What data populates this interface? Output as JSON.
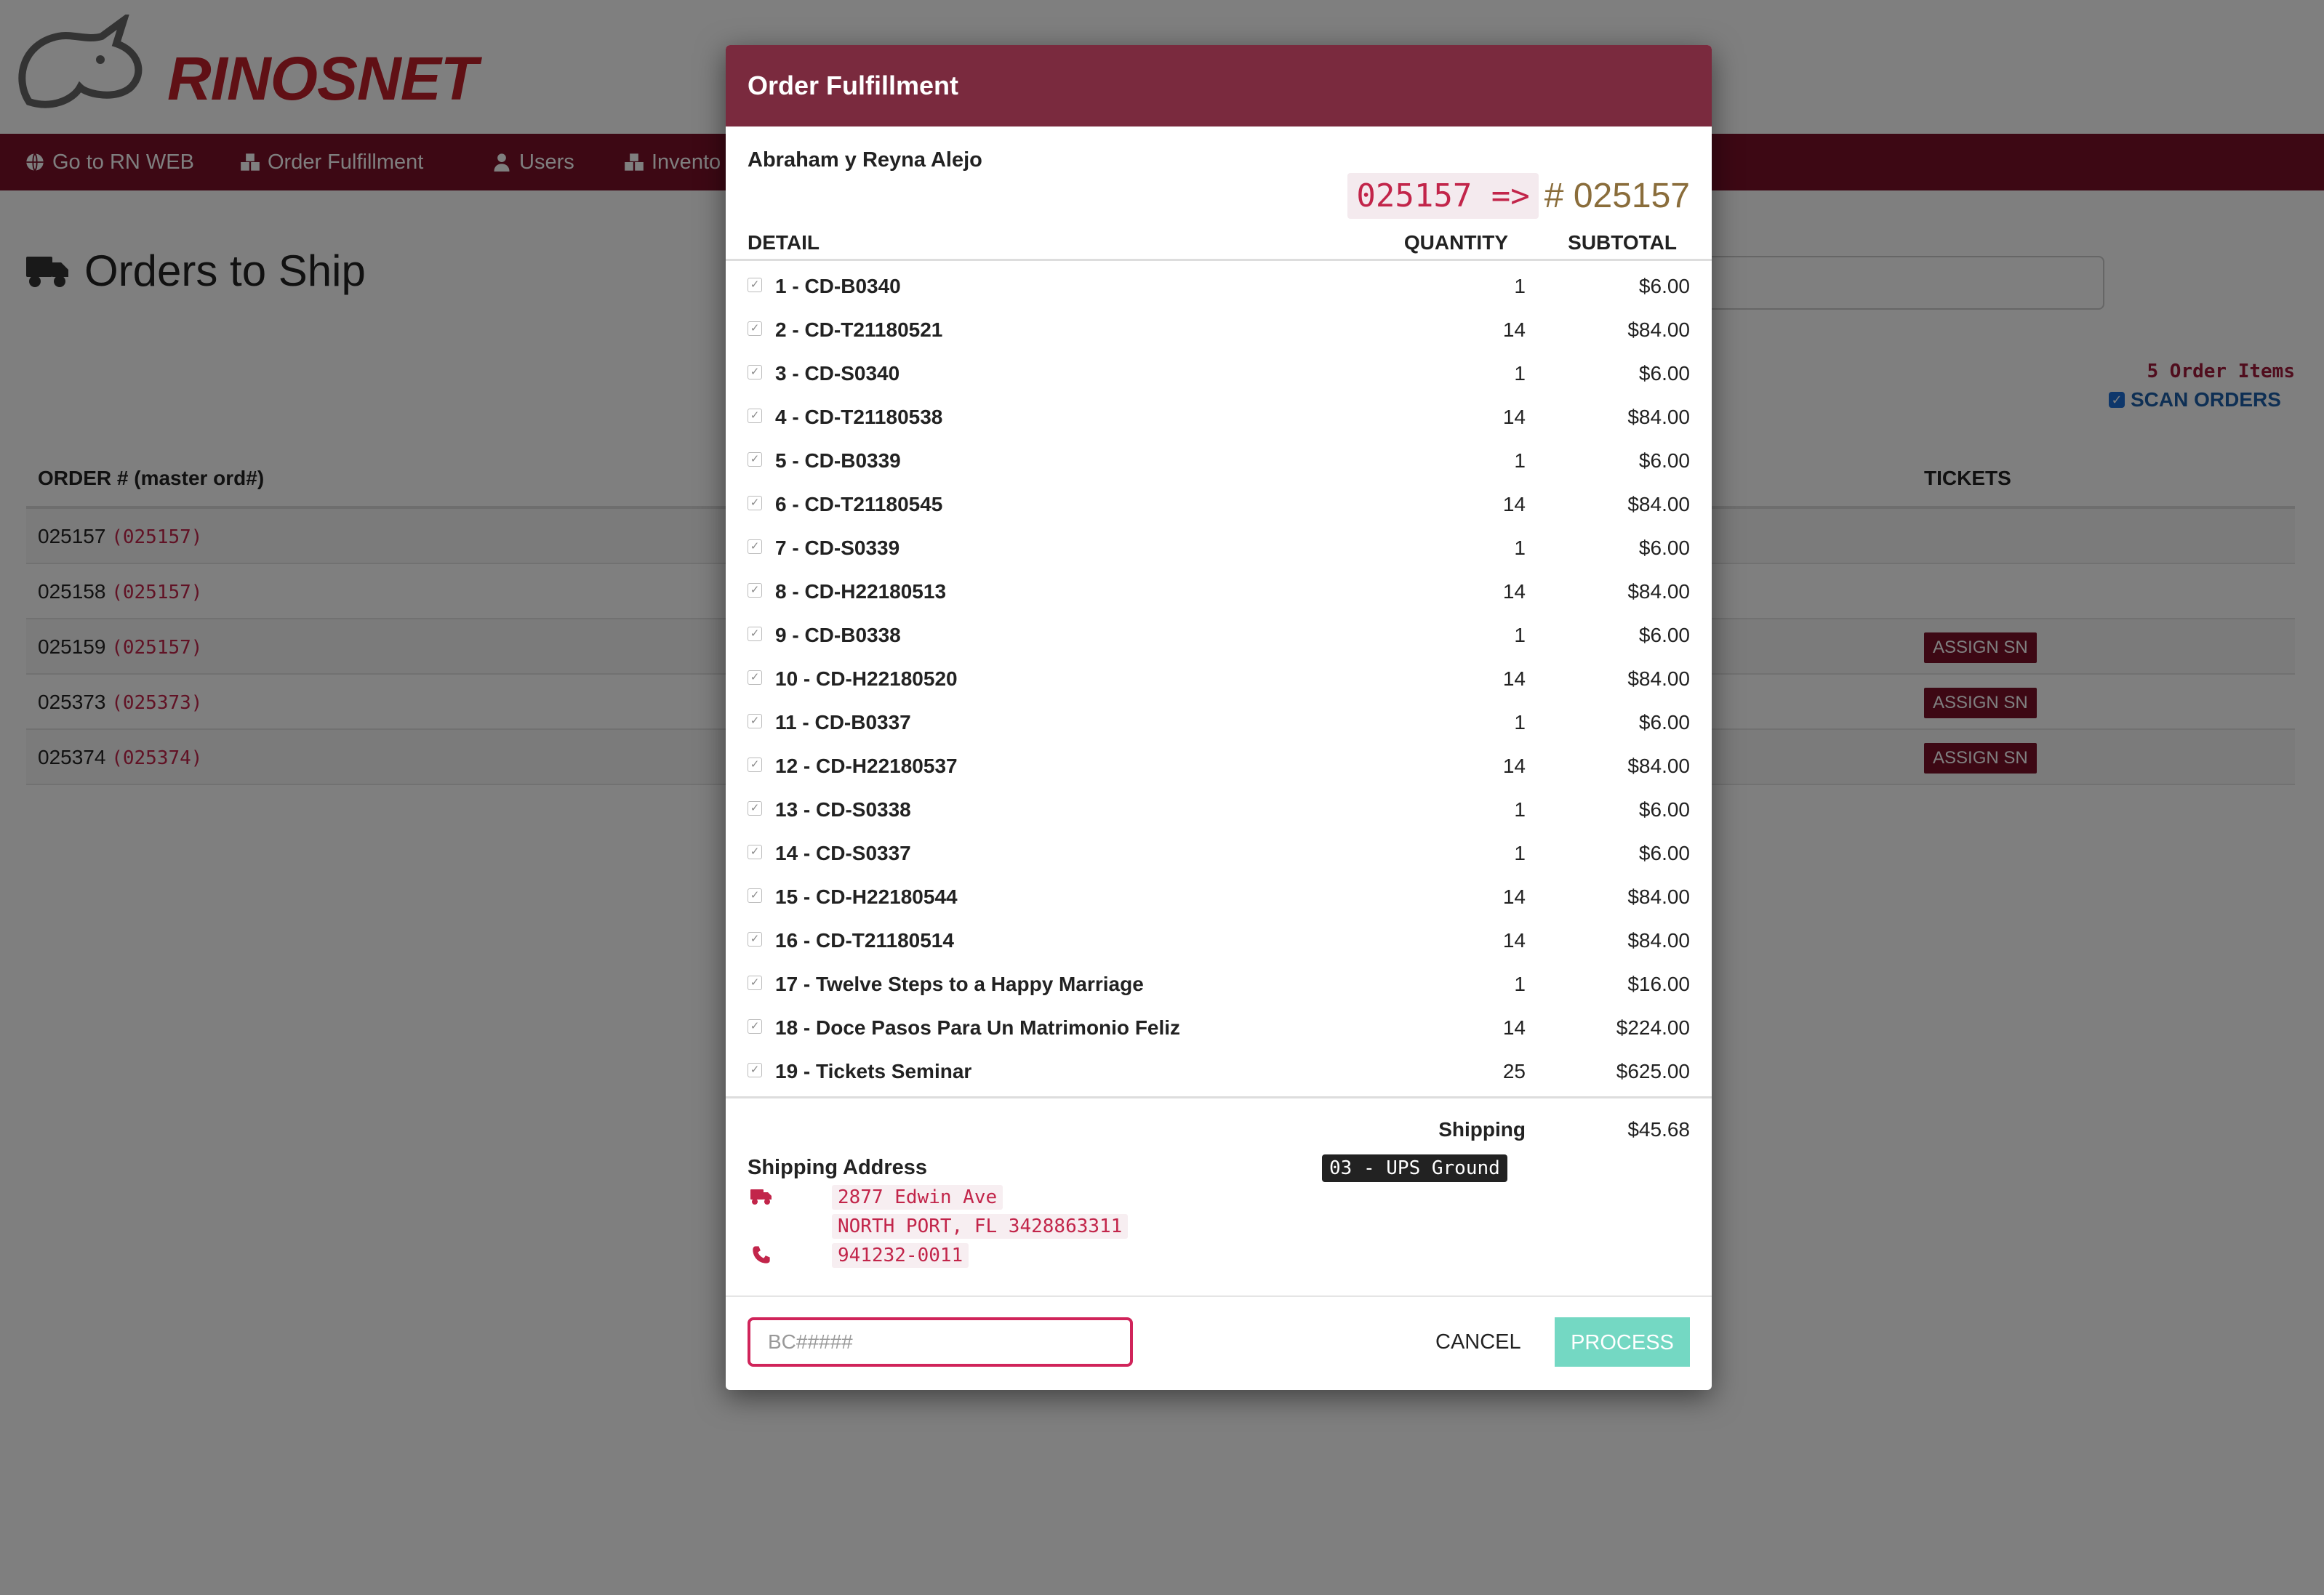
{
  "app": {
    "brand": "RINOSNET"
  },
  "nav": [
    {
      "label": "Go to RN WEB",
      "icon": "globe-icon"
    },
    {
      "label": "Order Fulfillment",
      "icon": "cubes-icon"
    },
    {
      "label": "Users",
      "icon": "user-icon"
    },
    {
      "label": "Invento",
      "icon": "cubes-icon"
    }
  ],
  "page": {
    "title": "Orders to Ship",
    "title_icon": "truck-icon"
  },
  "status": {
    "order_items": "5 Order Items",
    "scan_orders": "SCAN ORDERS"
  },
  "orders_table": {
    "col_order": "ORDER # (master ord#)",
    "col_tickets": "TICKETS",
    "assign_label": "ASSIGN SN",
    "rows": [
      {
        "order": "025157",
        "master": "(025157)",
        "assign": false
      },
      {
        "order": "025158",
        "master": "(025157)",
        "assign": false
      },
      {
        "order": "025159",
        "master": "(025157)",
        "assign": true
      },
      {
        "order": "025373",
        "master": "(025373)",
        "assign": true
      },
      {
        "order": "025374",
        "master": "(025374)",
        "assign": true
      }
    ]
  },
  "modal": {
    "title": "Order Fulfillment",
    "customer": "Abraham y Reyna Alejo",
    "order_code": "025157 =>",
    "order_number": "# 025157",
    "columns": {
      "detail": "DETAIL",
      "quantity": "QUANTITY",
      "subtotal": "SUBTOTAL"
    },
    "items": [
      {
        "label": "1 - CD-B0340",
        "qty": "1",
        "subtotal": "$6.00"
      },
      {
        "label": "2 - CD-T21180521",
        "qty": "14",
        "subtotal": "$84.00"
      },
      {
        "label": "3 - CD-S0340",
        "qty": "1",
        "subtotal": "$6.00"
      },
      {
        "label": "4 - CD-T21180538",
        "qty": "14",
        "subtotal": "$84.00"
      },
      {
        "label": "5 - CD-B0339",
        "qty": "1",
        "subtotal": "$6.00"
      },
      {
        "label": "6 - CD-T21180545",
        "qty": "14",
        "subtotal": "$84.00"
      },
      {
        "label": "7 - CD-S0339",
        "qty": "1",
        "subtotal": "$6.00"
      },
      {
        "label": "8 - CD-H22180513",
        "qty": "14",
        "subtotal": "$84.00"
      },
      {
        "label": "9 - CD-B0338",
        "qty": "1",
        "subtotal": "$6.00"
      },
      {
        "label": "10 - CD-H22180520",
        "qty": "14",
        "subtotal": "$84.00"
      },
      {
        "label": "11 - CD-B0337",
        "qty": "1",
        "subtotal": "$6.00"
      },
      {
        "label": "12 - CD-H22180537",
        "qty": "14",
        "subtotal": "$84.00"
      },
      {
        "label": "13 - CD-S0338",
        "qty": "1",
        "subtotal": "$6.00"
      },
      {
        "label": "14 - CD-S0337",
        "qty": "1",
        "subtotal": "$6.00"
      },
      {
        "label": "15 - CD-H22180544",
        "qty": "14",
        "subtotal": "$84.00"
      },
      {
        "label": "16 - CD-T21180514",
        "qty": "14",
        "subtotal": "$84.00"
      },
      {
        "label": "17 - Twelve Steps to a Happy Marriage",
        "qty": "1",
        "subtotal": "$16.00"
      },
      {
        "label": "18 - Doce Pasos Para Un Matrimonio Feliz",
        "qty": "14",
        "subtotal": "$224.00"
      },
      {
        "label": "19 - Tickets Seminar",
        "qty": "25",
        "subtotal": "$625.00"
      }
    ],
    "shipping_label": "Shipping",
    "shipping_value": "$45.68",
    "address_title": "Shipping Address",
    "carrier": "03 - UPS Ground",
    "address_line1": "2877 Edwin Ave",
    "address_line2": "NORTH PORT, FL 3428863311",
    "phone": "941232-0011",
    "barcode_placeholder": "BC#####",
    "barcode_value": "",
    "cancel_label": "CANCEL",
    "process_label": "PROCESS"
  }
}
